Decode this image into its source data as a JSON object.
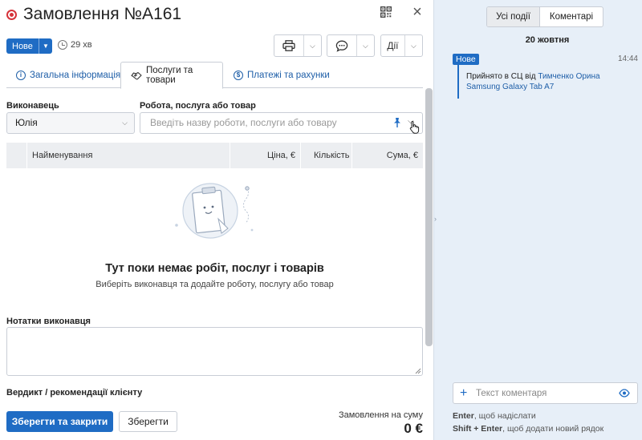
{
  "header": {
    "title": "Замовлення №A161",
    "status_label": "Нове",
    "timer": "29 хв",
    "actions_label": "Дії"
  },
  "tabs": [
    {
      "label": "Загальна інформація"
    },
    {
      "label": "Послуги та товари"
    },
    {
      "label": "Платежі та рахунки"
    }
  ],
  "form": {
    "executor_label": "Виконавець",
    "executor_value": "Юлія",
    "service_label": "Робота, послуга або товар",
    "service_placeholder": "Введіть назву роботи, послуги або товару"
  },
  "table": {
    "columns": [
      "Найменування",
      "Ціна, €",
      "Кількість",
      "Сума, €"
    ]
  },
  "empty": {
    "title": "Тут поки немає робіт, послуг і товарів",
    "subtitle": "Виберіть виконавця та додайте роботу, послугу або товар"
  },
  "notes": {
    "label": "Нотатки виконавця",
    "verdict_label": "Вердикт / рекомендації клієнту"
  },
  "footer": {
    "save_close": "Зберегти та закрити",
    "save": "Зберегти",
    "sum_label": "Замовлення на суму",
    "sum_value": "0 €"
  },
  "events_panel": {
    "filter_all": "Усі події",
    "filter_comments": "Коментарі",
    "date": "20 жовтня",
    "event": {
      "badge": "Нове",
      "time": "14:44",
      "text_prefix": "Прийнято в СЦ від ",
      "client": "Тимченко Орина",
      "device": "Samsung Galaxy Tab A7"
    },
    "comment_placeholder": "Текст коментаря",
    "hint_enter_key": "Enter",
    "hint_enter_text": ", щоб надіслати",
    "hint_shift_key": "Shift + Enter",
    "hint_shift_text": ", щоб додати новий рядок"
  },
  "colors": {
    "accent": "#1f6cc4",
    "record": "#d6333a",
    "panel_bg": "#e7eff8"
  }
}
